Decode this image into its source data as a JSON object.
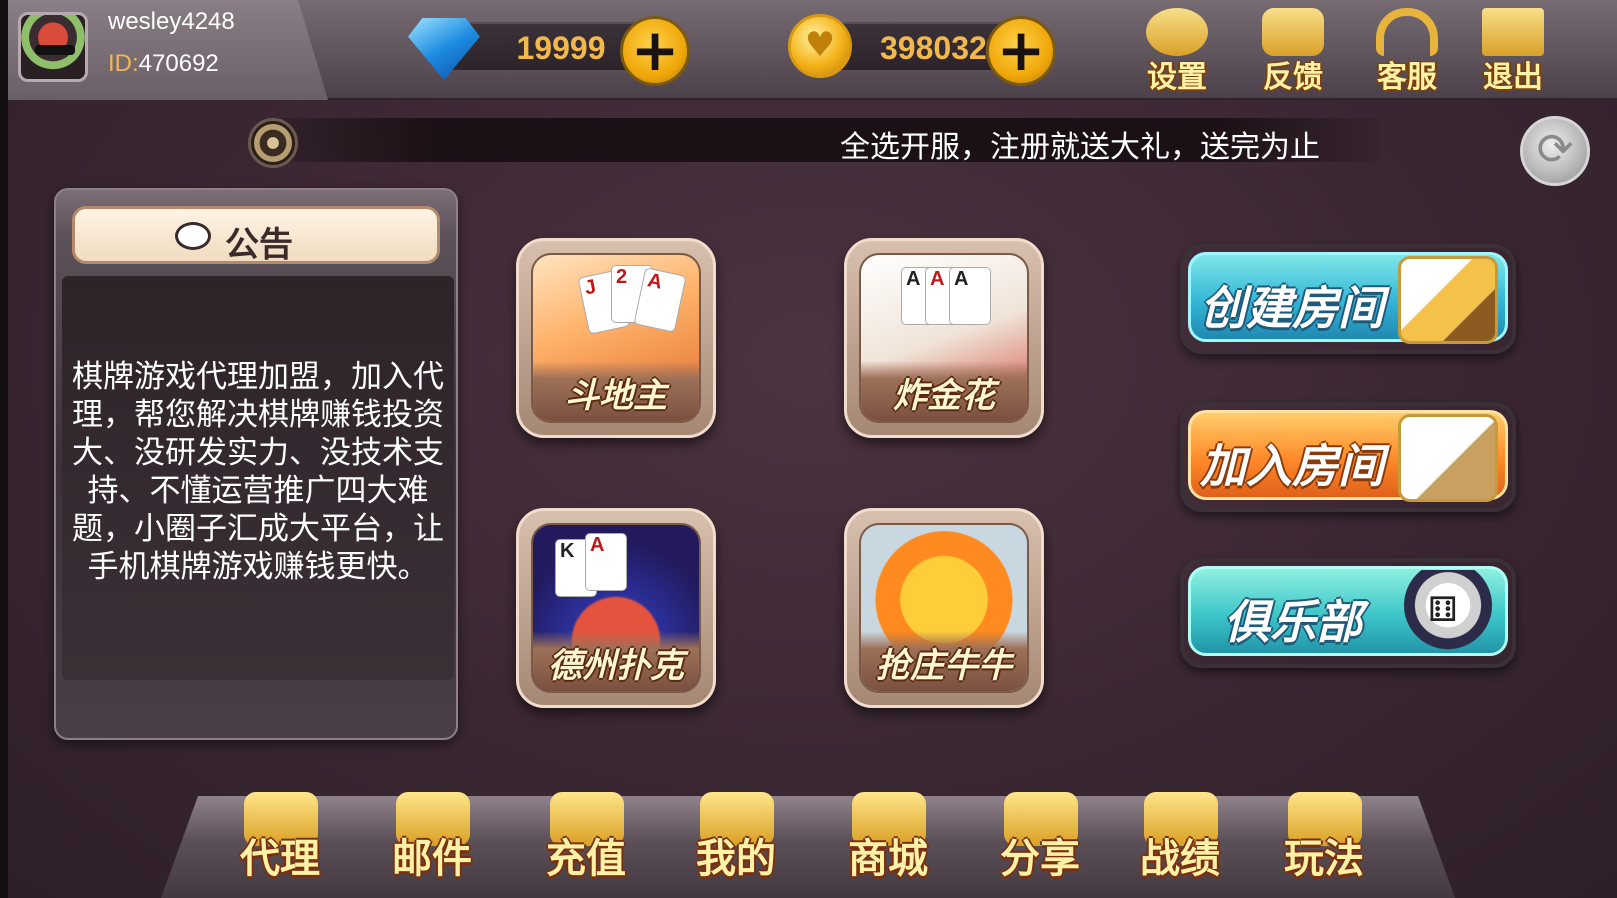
{
  "user": {
    "name": "wesley4248",
    "id_label": "ID:",
    "id_value": "470692"
  },
  "currency": {
    "diamonds": "19999",
    "coins": "398032",
    "add_symbol": "+"
  },
  "top_buttons": [
    {
      "label": "设置",
      "icon": "gear-icon"
    },
    {
      "label": "反馈",
      "icon": "feedback-icon"
    },
    {
      "label": "客服",
      "icon": "headset-icon"
    },
    {
      "label": "退出",
      "icon": "exit-icon"
    }
  ],
  "marquee": {
    "text": "全选开服，注册就送大礼，送完为止"
  },
  "notice": {
    "title": "公告",
    "body": "棋牌游戏代理加盟，加入代理，帮您解决棋牌赚钱投资大、没研发实力、没技术支持、不懂运营推广四大难题，小圈子汇成大平台，让手机棋牌游戏赚钱更快。"
  },
  "games": [
    {
      "label": "斗地主"
    },
    {
      "label": "炸金花"
    },
    {
      "label": "德州扑克"
    },
    {
      "label": "抢庄牛牛"
    }
  ],
  "room_buttons": {
    "create": "创建房间",
    "join": "加入房间",
    "club": "俱乐部"
  },
  "bottom_nav": [
    {
      "label": "代理",
      "icon": "agent-icon"
    },
    {
      "label": "邮件",
      "icon": "mail-icon"
    },
    {
      "label": "充值",
      "icon": "recharge-icon"
    },
    {
      "label": "我的",
      "icon": "profile-icon"
    },
    {
      "label": "商城",
      "icon": "cart-icon"
    },
    {
      "label": "分享",
      "icon": "share-icon"
    },
    {
      "label": "战绩",
      "icon": "trophy-icon"
    },
    {
      "label": "玩法",
      "icon": "gamepad-icon"
    }
  ],
  "colors": {
    "accent_gold": "#f2b84b",
    "background": "#3b2733",
    "create_button": "#34b6d8",
    "join_button": "#ff8a2a",
    "club_button": "#3cc6c8"
  }
}
